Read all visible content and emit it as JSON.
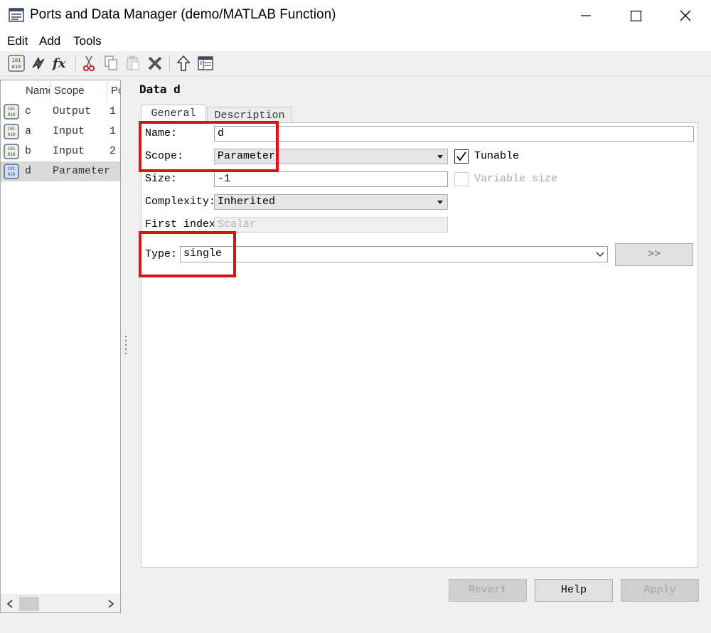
{
  "window": {
    "title": "Ports and Data Manager (demo/MATLAB Function)",
    "accent_highlight_color": "#e01010"
  },
  "menu": {
    "items": [
      "Edit",
      "Add",
      "Tools"
    ]
  },
  "toolbar": {
    "buttons": [
      "data-icon",
      "event-icon",
      "fx-icon",
      "cut-icon",
      "copy-icon",
      "paste-icon",
      "delete-icon",
      "up-arrow-icon",
      "model-explorer-icon"
    ]
  },
  "left_panel": {
    "columns": [
      "Name",
      "Scope",
      "Po"
    ],
    "rows": [
      {
        "name": "c",
        "scope": "Output",
        "port": "1"
      },
      {
        "name": "a",
        "scope": "Input",
        "port": "1"
      },
      {
        "name": "b",
        "scope": "Input",
        "port": "2"
      },
      {
        "name": "d",
        "scope": "Parameter",
        "port": ""
      }
    ],
    "selected_row": "d"
  },
  "detail": {
    "title": "Data d",
    "tabs": [
      "General",
      "Description"
    ],
    "active_tab": "General",
    "fields": {
      "name_label": "Name:",
      "name_value": "d",
      "scope_label": "Scope:",
      "scope_value": "Parameter",
      "tunable_label": "Tunable",
      "size_label": "Size:",
      "size_value": "-1",
      "variable_size_label": "Variable size",
      "complexity_label": "Complexity:",
      "complexity_value": "Inherited",
      "first_index_label": "First index",
      "first_index_value": "Scalar",
      "type_label": "Type:",
      "type_value": "single",
      "type_expand_label": ">>"
    },
    "buttons": {
      "revert": "Revert",
      "help": "Help",
      "apply": "Apply"
    }
  }
}
